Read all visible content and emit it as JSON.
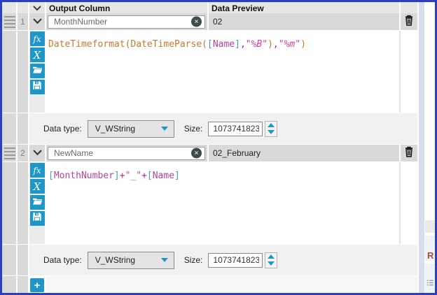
{
  "colors": {
    "accent": "#1e96c8",
    "frame": "#2a3fc4",
    "tok-fn": "#c87a2e",
    "tok-br": "#3b9fc6",
    "tok-fld": "#b8439c",
    "tok-op": "#9c2d92",
    "tok-str": "#d444a8"
  },
  "header": {
    "output_column": "Output Column",
    "data_preview": "Data Preview"
  },
  "rows": [
    {
      "number": "1",
      "output_name": "MonthNumber",
      "preview": "02",
      "formula": [
        {
          "t": "DateTimeformat(",
          "c": "fn"
        },
        {
          "t": "DateTimeParse(",
          "c": "fn"
        },
        {
          "t": "[",
          "c": "br"
        },
        {
          "t": "Name",
          "c": "fld"
        },
        {
          "t": "]",
          "c": "br"
        },
        {
          "t": ",",
          "c": "op"
        },
        {
          "t": "\"%B\"",
          "c": "str"
        },
        {
          "t": ")",
          "c": "fn"
        },
        {
          "t": ",",
          "c": "op"
        },
        {
          "t": "\"%m\"",
          "c": "str"
        },
        {
          "t": ")",
          "c": "fn"
        }
      ],
      "datatype": {
        "label": "Data type:",
        "value": "V_WString",
        "size_label": "Size:",
        "size_value": "1073741823"
      }
    },
    {
      "number": "2",
      "output_name": "NewName",
      "preview": "02_February",
      "formula": [
        {
          "t": "[",
          "c": "br"
        },
        {
          "t": "MonthNumber",
          "c": "fld"
        },
        {
          "t": "]",
          "c": "br"
        },
        {
          "t": "+",
          "c": "op"
        },
        {
          "t": "\"_\"",
          "c": "str"
        },
        {
          "t": "+",
          "c": "op"
        },
        {
          "t": "[",
          "c": "br"
        },
        {
          "t": "Name",
          "c": "fld"
        },
        {
          "t": "]",
          "c": "br"
        }
      ],
      "datatype": {
        "label": "Data type:",
        "value": "V_WString",
        "size_label": "Size:",
        "size_value": "1073741823"
      }
    }
  ],
  "side_buttons": {
    "fx_glyph": "fx",
    "variable_glyph": "X"
  },
  "icons": {
    "clear": "✕"
  },
  "add_button_label": "+",
  "right_panel": {
    "partial_text": "R"
  }
}
